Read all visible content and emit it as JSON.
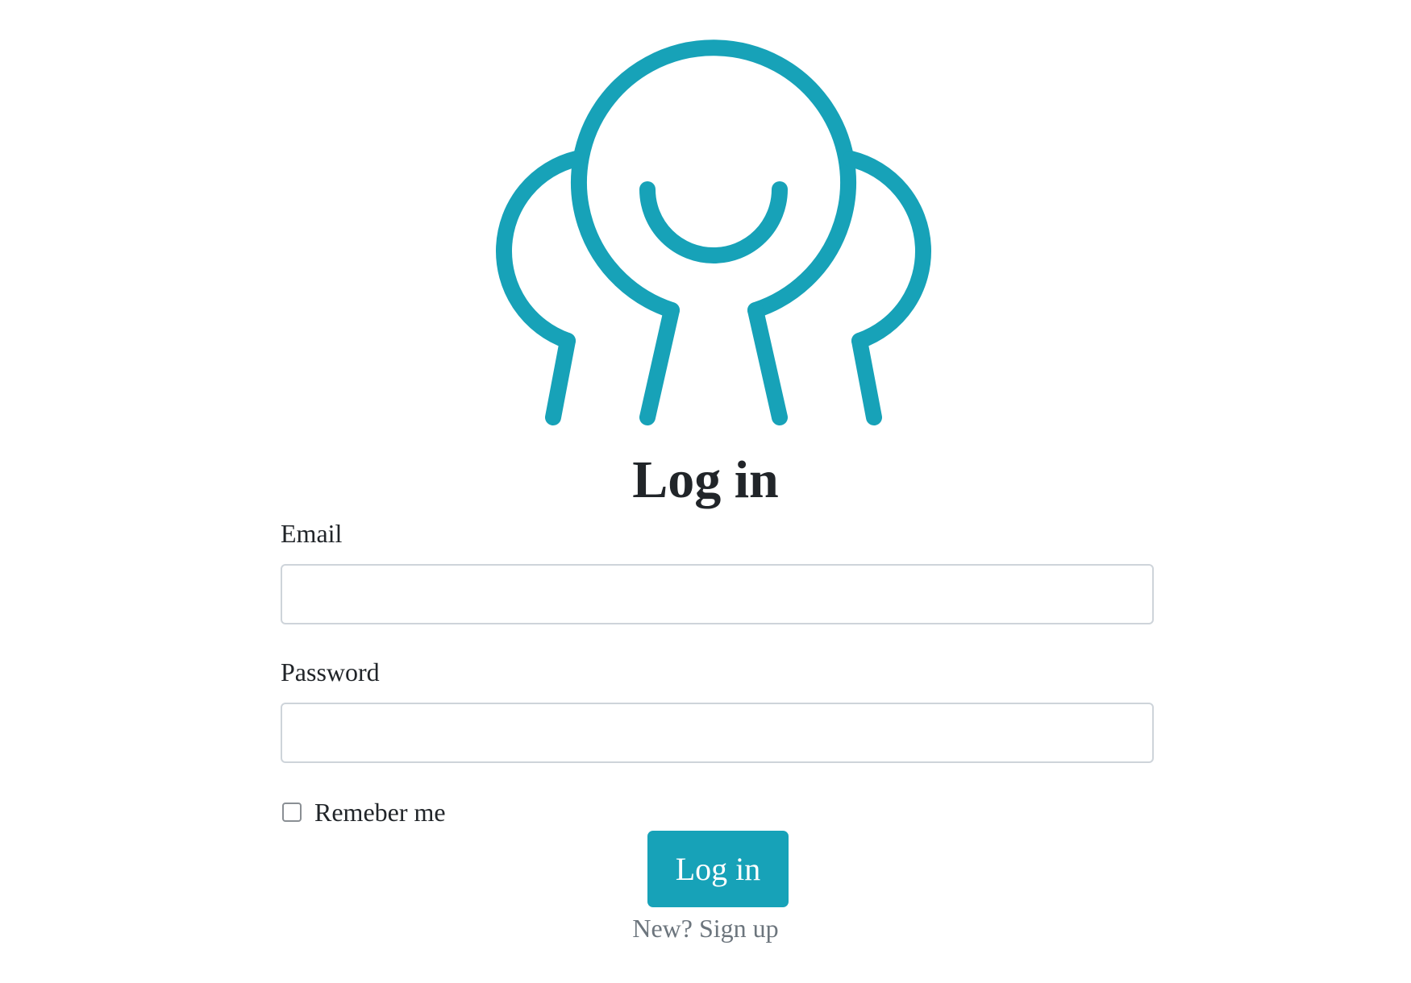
{
  "logo": {
    "name": "logo-people-icon",
    "color": "#17a2b8"
  },
  "title": "Log in",
  "form": {
    "email_label": "Email",
    "email_value": "",
    "password_label": "Password",
    "password_value": "",
    "remember_label": "Remeber me",
    "remember_checked": false,
    "submit_label": "Log in"
  },
  "signup": {
    "text": "New? Sign up"
  },
  "colors": {
    "accent": "#17a2b8",
    "text": "#212529",
    "muted": "#6c757d",
    "input_border": "#ced4da"
  }
}
